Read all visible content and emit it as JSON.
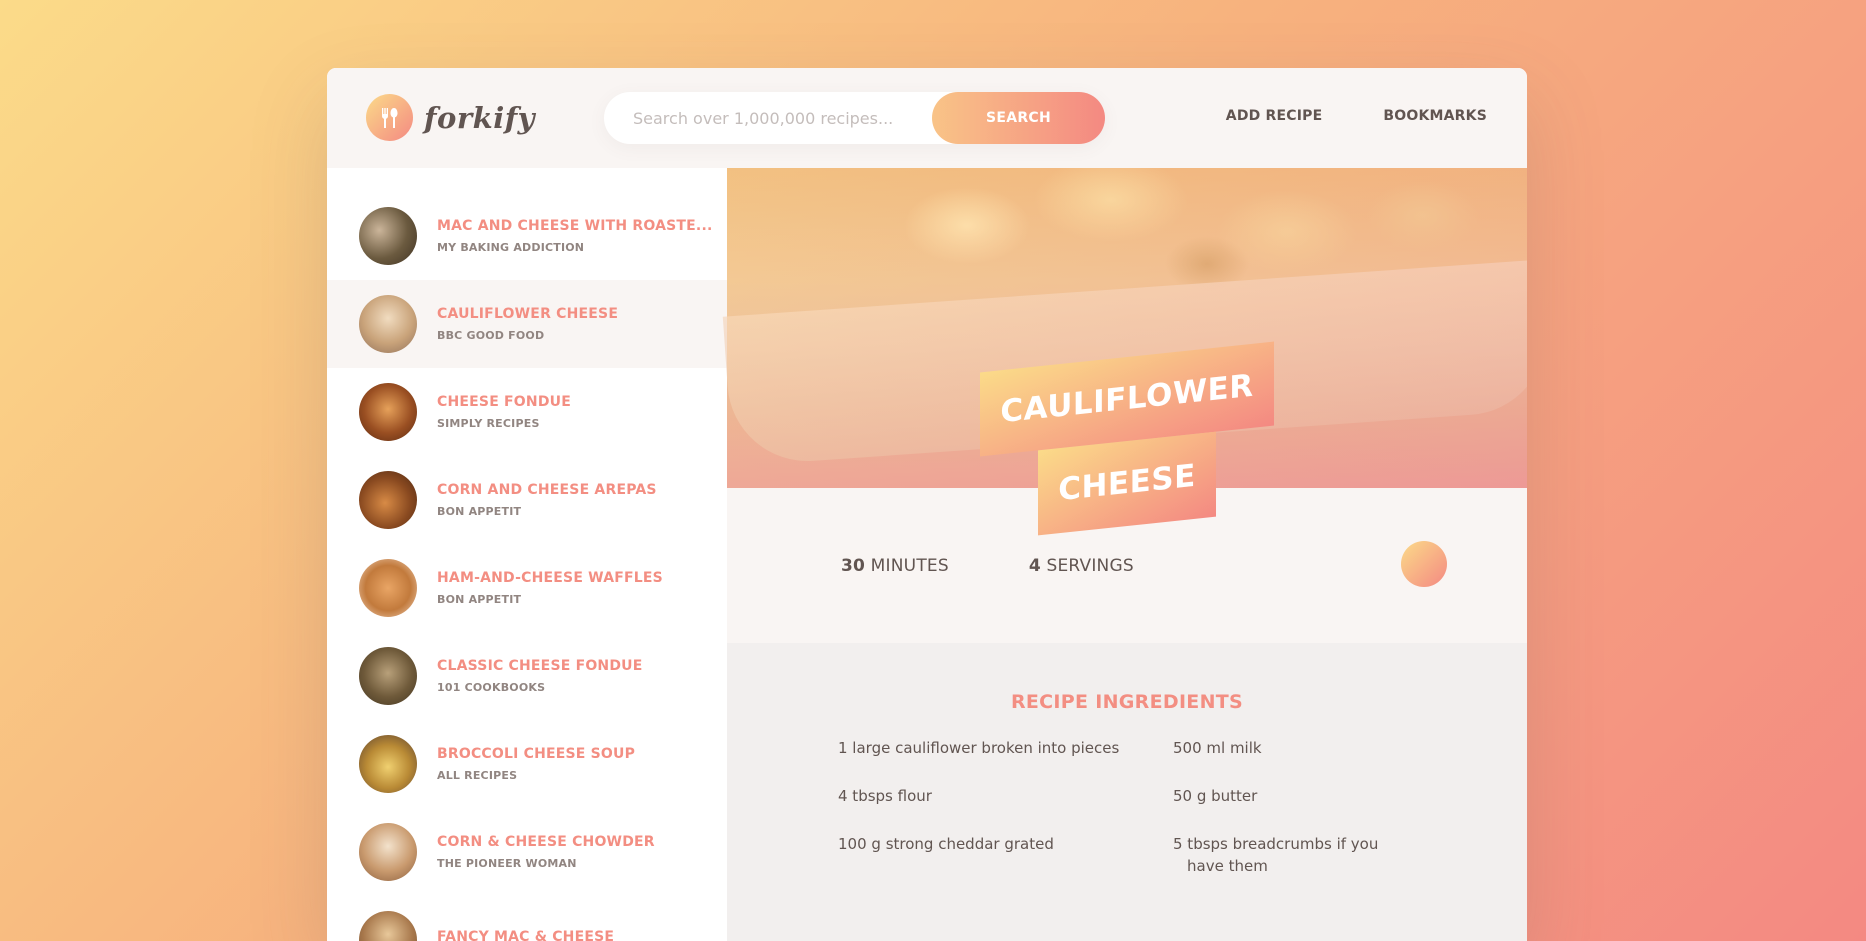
{
  "header": {
    "logo_text": "forkify",
    "search_placeholder": "Search over 1,000,000 recipes...",
    "search_button": "SEARCH",
    "nav": [
      "ADD RECIPE",
      "BOOKMARKS"
    ]
  },
  "results": [
    {
      "title": "MAC AND CHEESE WITH ROASTE...",
      "publisher": "MY BAKING ADDICTION",
      "active": false
    },
    {
      "title": "CAULIFLOWER CHEESE",
      "publisher": "BBC GOOD FOOD",
      "active": true
    },
    {
      "title": "CHEESE FONDUE",
      "publisher": "SIMPLY RECIPES",
      "active": false
    },
    {
      "title": "CORN AND CHEESE AREPAS",
      "publisher": "BON APPETIT",
      "active": false
    },
    {
      "title": "HAM-AND-CHEESE WAFFLES",
      "publisher": "BON APPETIT",
      "active": false
    },
    {
      "title": "CLASSIC CHEESE FONDUE",
      "publisher": "101 COOKBOOKS",
      "active": false
    },
    {
      "title": "BROCCOLI CHEESE SOUP",
      "publisher": "ALL RECIPES",
      "active": false
    },
    {
      "title": "CORN & CHEESE CHOWDER",
      "publisher": "THE PIONEER WOMAN",
      "active": false
    },
    {
      "title": "FANCY MAC & CHEESE",
      "publisher": "",
      "active": false
    }
  ],
  "recipe": {
    "title_line1": "CAULIFLOWER",
    "title_line2": "CHEESE",
    "minutes_value": "30",
    "minutes_label": "MINUTES",
    "servings_value": "4",
    "servings_label": "SERVINGS",
    "ingredients_heading": "RECIPE INGREDIENTS",
    "ingredients": [
      "1 large cauliflower broken into pieces",
      "500 ml milk",
      "4 tbsps flour",
      "50 g butter",
      "100 g strong cheddar grated",
      "5 tbsps breadcrumbs if you have them"
    ]
  },
  "colors": {
    "accent": "#f38e82",
    "gradient_start": "#fbdb89",
    "gradient_end": "#f48982",
    "text": "#615551",
    "panel_bg": "#f9f5f3"
  }
}
